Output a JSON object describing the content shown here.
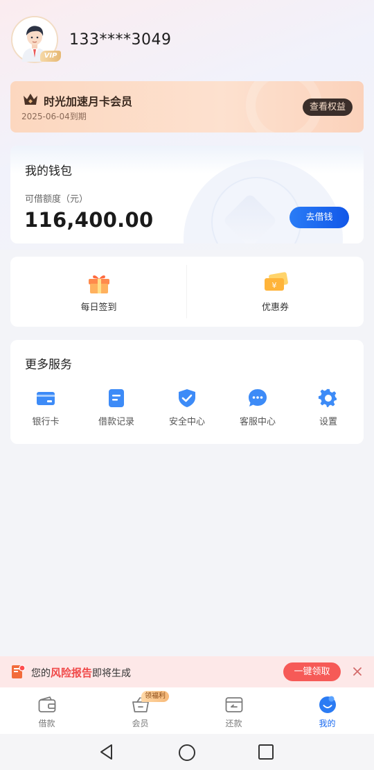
{
  "profile": {
    "phone": "133****3049",
    "vip_badge": "VIP"
  },
  "vip_card": {
    "title": "时光加速月卡会员",
    "expire": "2025-06-04到期",
    "rights_button": "查看权益"
  },
  "wallet": {
    "title": "我的钱包",
    "limit_label": "可借额度（元）",
    "limit_amount": "116,400.00",
    "borrow_button": "去借钱"
  },
  "quick_actions": [
    {
      "label": "每日签到",
      "icon": "gift-icon"
    },
    {
      "label": "优惠券",
      "icon": "coupon-icon"
    }
  ],
  "more_services": {
    "title": "更多服务",
    "items": [
      {
        "label": "银行卡",
        "icon": "bank-card-icon"
      },
      {
        "label": "借款记录",
        "icon": "document-icon"
      },
      {
        "label": "安全中心",
        "icon": "shield-check-icon"
      },
      {
        "label": "客服中心",
        "icon": "chat-bubble-icon"
      },
      {
        "label": "设置",
        "icon": "gear-icon"
      }
    ]
  },
  "notice": {
    "prefix": "您的",
    "highlight": "风险报告",
    "suffix": "即将生成",
    "claim_button": "一键领取"
  },
  "tabbar": {
    "items": [
      {
        "label": "借款",
        "icon": "wallet-icon",
        "active": false
      },
      {
        "label": "会员",
        "icon": "basket-icon",
        "active": false,
        "badge": "领福利"
      },
      {
        "label": "还款",
        "icon": "card-icon",
        "active": false
      },
      {
        "label": "我的",
        "icon": "smile-icon",
        "active": true
      }
    ]
  },
  "colors": {
    "accent_blue": "#1667f0",
    "notice_red": "#f04848",
    "vip_gold": "#e6b873"
  }
}
